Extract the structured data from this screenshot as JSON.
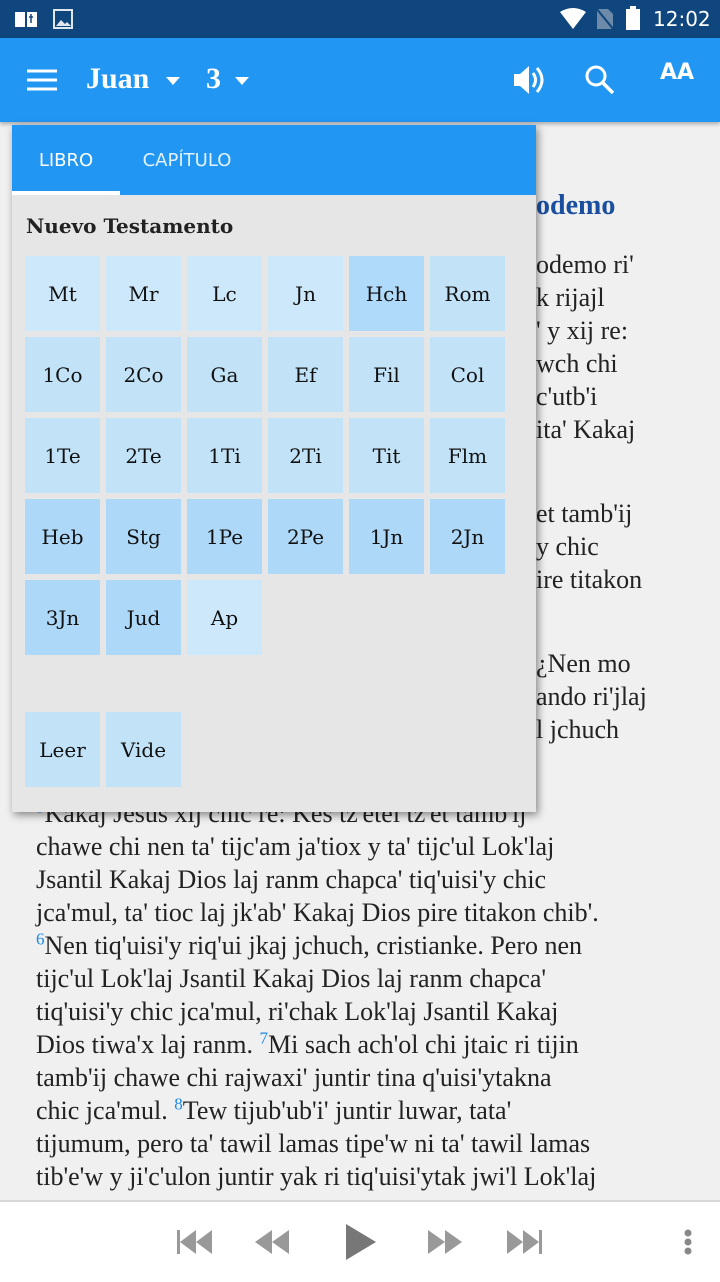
{
  "status_bar": {
    "time": "12:02",
    "icons": [
      "bible-app-icon",
      "image-icon",
      "wifi-icon",
      "no-sim-icon",
      "battery-icon"
    ]
  },
  "toolbar": {
    "book": "Juan",
    "chapter": "3",
    "icons": [
      "menu-icon",
      "speaker-icon",
      "search-icon",
      "text-size-icon"
    ],
    "text_size_label": "AA"
  },
  "popup": {
    "tabs": [
      {
        "label": "LIBRO",
        "active": true
      },
      {
        "label": "CAPÍTULO",
        "active": false
      }
    ],
    "section_title": "Nuevo Testamento",
    "books": [
      {
        "label": "Mt",
        "color": "#cde8fb"
      },
      {
        "label": "Mr",
        "color": "#cde8fb"
      },
      {
        "label": "Lc",
        "color": "#cde8fb"
      },
      {
        "label": "Jn",
        "color": "#cde8fb"
      },
      {
        "label": "Hch",
        "color": "#b0dafa"
      },
      {
        "label": "Rom",
        "color": "#c2e2f8"
      },
      {
        "label": "1Co",
        "color": "#c2e2f8"
      },
      {
        "label": "2Co",
        "color": "#c2e2f8"
      },
      {
        "label": "Ga",
        "color": "#c2e2f8"
      },
      {
        "label": "Ef",
        "color": "#c2e2f8"
      },
      {
        "label": "Fil",
        "color": "#c2e2f8"
      },
      {
        "label": "Col",
        "color": "#c2e2f8"
      },
      {
        "label": "1Te",
        "color": "#c2e2f8"
      },
      {
        "label": "2Te",
        "color": "#c2e2f8"
      },
      {
        "label": "1Ti",
        "color": "#c2e2f8"
      },
      {
        "label": "2Ti",
        "color": "#c2e2f8"
      },
      {
        "label": "Tit",
        "color": "#c2e2f8"
      },
      {
        "label": "Flm",
        "color": "#c2e2f8"
      },
      {
        "label": "Heb",
        "color": "#aed8f8"
      },
      {
        "label": "Stg",
        "color": "#aed8f8"
      },
      {
        "label": "1Pe",
        "color": "#aed8f8"
      },
      {
        "label": "2Pe",
        "color": "#aed8f8"
      },
      {
        "label": "1Jn",
        "color": "#aed8f8"
      },
      {
        "label": "2Jn",
        "color": "#aed8f8"
      },
      {
        "label": "3Jn",
        "color": "#aed8f8"
      },
      {
        "label": "Jud",
        "color": "#aed8f8"
      },
      {
        "label": "Ap",
        "color": "#cde8fb"
      }
    ],
    "extras": [
      {
        "label": "Leer",
        "color": "#c2e2f8"
      },
      {
        "label": "Vide",
        "color": "#c2e2f8"
      }
    ]
  },
  "content": {
    "heading_fragment": "odemo",
    "right_fragments": [
      "odemo ri'",
      "k rijajl",
      "' y xij re:",
      "wch chi",
      "c'utb'i",
      "ita' Kakaj",
      "et tamb'ij",
      "y chic",
      "ire titakon",
      "¿Nen mo",
      "ando ri'jlaj",
      "l jchuch"
    ],
    "lines": [
      [
        {
          "v": "5"
        },
        {
          "t": "Kakaj Jesus xij chic re: Kes tz'etel tz'et tamb'ij"
        }
      ],
      [
        {
          "t": "chawe chi nen ta' tijc'am ja'tiox y ta' tijc'ul Lok'laj"
        }
      ],
      [
        {
          "t": "Jsantil Kakaj Dios laj ranm chapca' tiq'uisi'y chic"
        }
      ],
      [
        {
          "t": "jca'mul, ta' tioc laj jk'ab' Kakaj Dios pire titakon chib'."
        }
      ],
      [
        {
          "v": "6"
        },
        {
          "t": "Nen tiq'uisi'y riq'ui jkaj jchuch, cristianke. Pero nen"
        }
      ],
      [
        {
          "t": "tijc'ul Lok'laj Jsantil Kakaj Dios laj ranm chapca'"
        }
      ],
      [
        {
          "t": "tiq'uisi'y chic jca'mul, ri'chak Lok'laj Jsantil Kakaj"
        }
      ],
      [
        {
          "t": "Dios tiwa'x laj ranm. "
        },
        {
          "v": "7"
        },
        {
          "t": "Mi sach ach'ol chi jtaic ri tijin"
        }
      ],
      [
        {
          "t": "tamb'ij chawe chi rajwaxi' juntir tina q'uisi'ytakna"
        }
      ],
      [
        {
          "t": "chic jca'mul. "
        },
        {
          "v": "8"
        },
        {
          "t": "Tew tijub'ub'i' juntir luwar, tata'"
        }
      ],
      [
        {
          "t": "tijumum, pero ta' tawil lamas tipe'w ni ta' tawil lamas"
        }
      ],
      [
        {
          "t": "tib'e'w y ji'c'ulon juntir yak ri tiq'uisi'ytak jwi'l Lok'laj"
        }
      ]
    ]
  },
  "player": {
    "icons": [
      "skip-previous-icon",
      "rewind-icon",
      "play-icon",
      "fast-forward-icon",
      "skip-next-icon",
      "more-vert-icon"
    ]
  },
  "colors": {
    "status_bar": "#10467e",
    "toolbar": "#2196f3",
    "heading": "#1a4fa0",
    "verse_number": "#1e88e5"
  }
}
